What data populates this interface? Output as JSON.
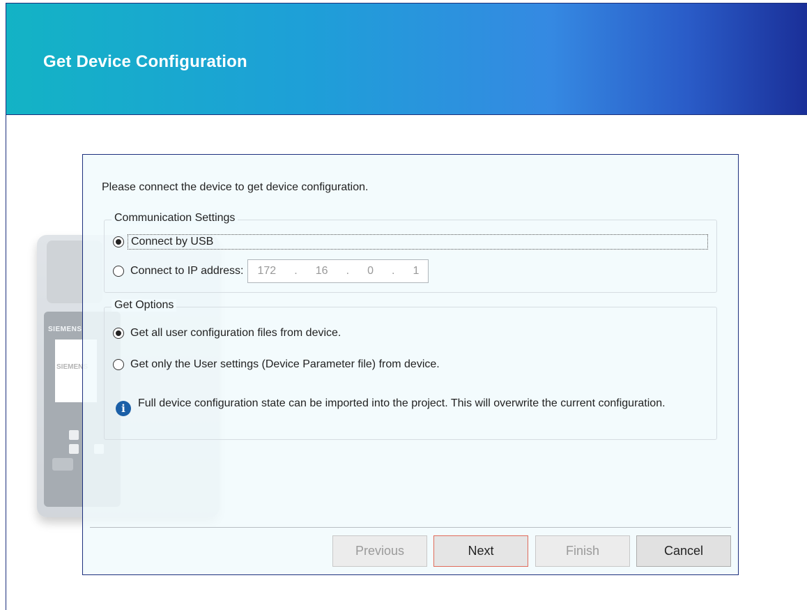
{
  "window": {
    "title": "Get Device Configuration"
  },
  "device_illustration": {
    "brand": "SIEMENS",
    "screen_brand": "SIEMENS"
  },
  "dialog": {
    "instruction": "Please connect the device to get device configuration.",
    "communication": {
      "legend": "Communication Settings",
      "usb_label": "Connect by USB",
      "usb_selected": true,
      "ip_label": "Connect to IP address:",
      "ip_selected": false,
      "ip_octets": [
        "172",
        "16",
        "0",
        "1"
      ],
      "ip_separator": "."
    },
    "options": {
      "legend": "Get Options",
      "all_files_label": "Get all user configuration files from device.",
      "all_files_selected": true,
      "user_settings_label": "Get only the User settings (Device Parameter file) from device.",
      "user_settings_selected": false,
      "info_text": "Full device configuration state can be imported into the project. This will overwrite the current configuration.",
      "info_icon": "info-icon"
    }
  },
  "buttons": {
    "previous": "Previous",
    "next": "Next",
    "finish": "Finish",
    "cancel": "Cancel"
  },
  "colors": {
    "banner_start": "#13b3c5",
    "banner_end": "#1a2f98",
    "frame": "#1c2f7d",
    "default_button_border": "#e06b5a",
    "info_icon": "#1b5fa7"
  }
}
